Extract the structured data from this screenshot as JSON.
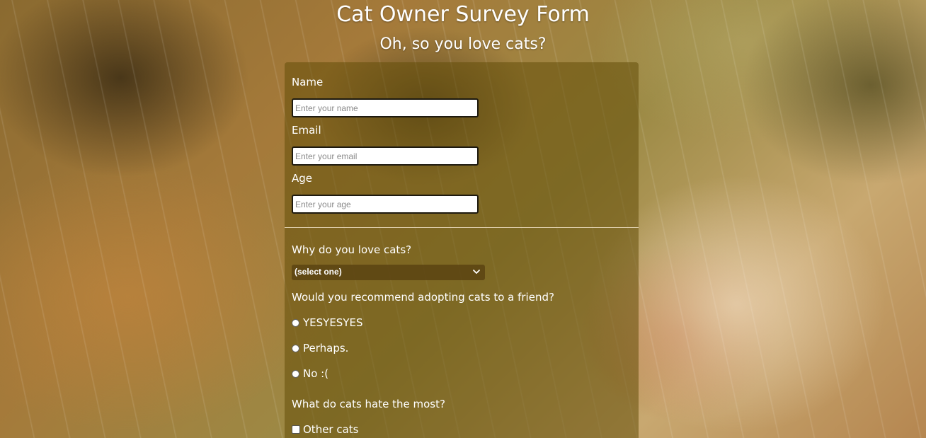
{
  "header": {
    "title": "Cat Owner Survey Form",
    "subtitle": "Oh, so you love cats?"
  },
  "form": {
    "name": {
      "label": "Name",
      "placeholder": "Enter your name",
      "value": ""
    },
    "email": {
      "label": "Email",
      "placeholder": "Enter your email",
      "value": ""
    },
    "age": {
      "label": "Age",
      "placeholder": "Enter your age",
      "value": ""
    },
    "why_love": {
      "label": "Why do you love cats?",
      "selected": "(select one)",
      "icon": "chevron-down-icon"
    },
    "recommend": {
      "label": "Would you recommend adopting cats to a friend?",
      "options": [
        "YESYESYES",
        "Perhaps.",
        "No :("
      ]
    },
    "hate": {
      "label": "What do cats hate the most?",
      "options": [
        "Other cats"
      ]
    }
  },
  "colors": {
    "panel": "#644e0a",
    "text": "#ffffff",
    "divider": "#ebdcbe"
  }
}
